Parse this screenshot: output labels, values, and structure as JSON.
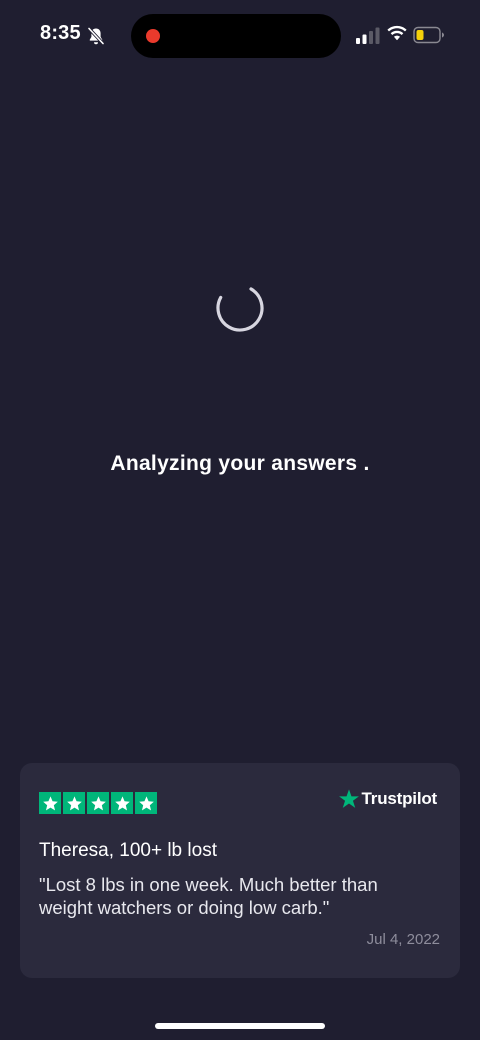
{
  "status_bar": {
    "time": "8:35"
  },
  "loader": {
    "message": "Analyzing your answers ."
  },
  "review": {
    "rating_stars": 5,
    "source": "Trustpilot",
    "reviewer": "Theresa, 100+ lb lost",
    "text": "\"Lost 8 lbs in one week. Much better than weight watchers or doing low carb.\"",
    "date": "Jul 4, 2022"
  },
  "colors": {
    "background": "#1f1e30",
    "card": "#2b2a3d",
    "trustpilot_green": "#00b67a",
    "record_dot": "#ea3a2c"
  },
  "icons": [
    "bell-slash-icon",
    "signal-icon",
    "wifi-icon",
    "battery-icon",
    "loading-spinner-icon",
    "star-icon",
    "trustpilot-star-icon"
  ]
}
